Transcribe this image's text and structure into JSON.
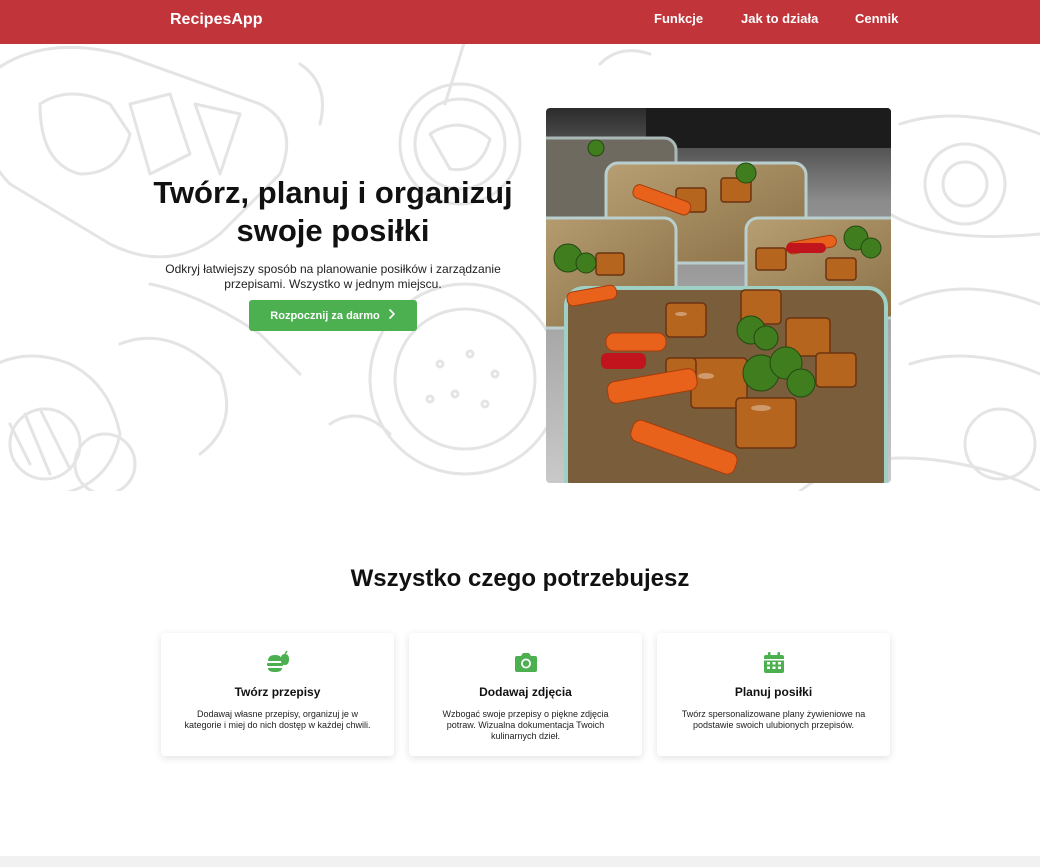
{
  "nav": {
    "brand": "RecipesApp",
    "links": [
      "Funkcje",
      "Jak to działa",
      "Cennik"
    ]
  },
  "hero": {
    "title": "Twórz, planuj i organizuj swoje posiłki",
    "subtitle": "Odkryj łatwiejszy sposób na planowanie posiłków i zarządzanie przepisami. Wszystko w jednym miejscu.",
    "cta_label": "Rozpocznij za darmo",
    "cta_icon": "chevron-right-icon"
  },
  "features": {
    "title": "Wszystko czego potrzebujesz",
    "cards": [
      {
        "icon": "burger-apple-icon",
        "title": "Twórz przepisy",
        "description": "Dodawaj własne przepisy, organizuj je w kategorie i miej do nich dostęp w każdej chwili."
      },
      {
        "icon": "camera-icon",
        "title": "Dodawaj zdjęcia",
        "description": "Wzbogać swoje przepisy o piękne zdjęcia potraw. Wizualna dokumentacja Twoich kulinarnych dzieł."
      },
      {
        "icon": "calendar-icon",
        "title": "Planuj posiłki",
        "description": "Twórz spersonalizowane plany żywieniowe na podstawie swoich ulubionych przepisów."
      }
    ]
  },
  "colors": {
    "navbar": "#c1343a",
    "accent": "#4caf50",
    "doodle_stroke": "#e4e4e4"
  }
}
